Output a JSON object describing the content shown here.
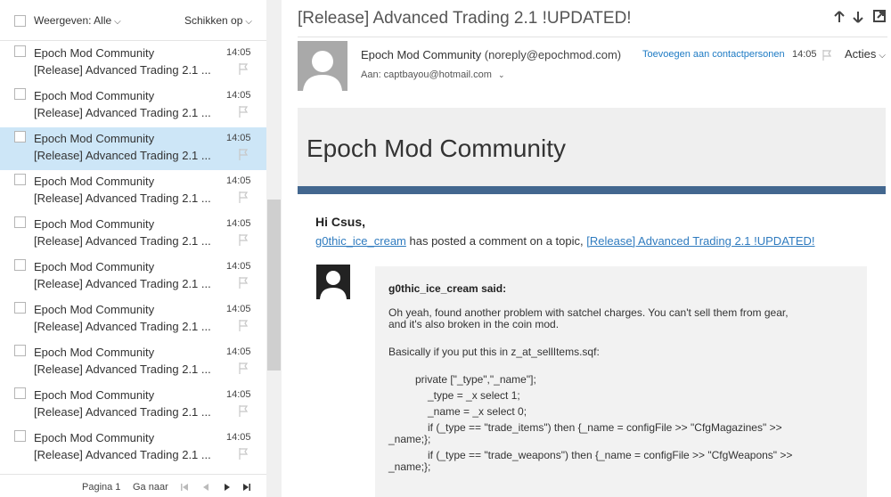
{
  "list": {
    "filter_label": "Weergeven: Alle",
    "sort_label": "Schikken op",
    "messages": [
      {
        "from": "Epoch Mod Community",
        "subject": "[Release] Advanced Trading 2.1 ...",
        "time": "14:05"
      },
      {
        "from": "Epoch Mod Community",
        "subject": "[Release] Advanced Trading 2.1 ...",
        "time": "14:05"
      },
      {
        "from": "Epoch Mod Community",
        "subject": "[Release] Advanced Trading 2.1 ...",
        "time": "14:05"
      },
      {
        "from": "Epoch Mod Community",
        "subject": "[Release] Advanced Trading 2.1 ...",
        "time": "14:05"
      },
      {
        "from": "Epoch Mod Community",
        "subject": "[Release] Advanced Trading 2.1 ...",
        "time": "14:05"
      },
      {
        "from": "Epoch Mod Community",
        "subject": "[Release] Advanced Trading 2.1 ...",
        "time": "14:05"
      },
      {
        "from": "Epoch Mod Community",
        "subject": "[Release] Advanced Trading 2.1 ...",
        "time": "14:05"
      },
      {
        "from": "Epoch Mod Community",
        "subject": "[Release] Advanced Trading 2.1 ...",
        "time": "14:05"
      },
      {
        "from": "Epoch Mod Community",
        "subject": "[Release] Advanced Trading 2.1 ...",
        "time": "14:05"
      },
      {
        "from": "Epoch Mod Community",
        "subject": "[Release] Advanced Trading 2.1 ...",
        "time": "14:05"
      }
    ],
    "selected_index": 2,
    "pager": {
      "page_label": "Pagina 1",
      "goto_label": "Ga naar"
    }
  },
  "reading": {
    "subject": "[Release] Advanced Trading 2.1 !UPDATED!",
    "sender_name": "Epoch Mod Community",
    "sender_email": "(noreply@epochmod.com)",
    "add_contact_label": "Toevoegen aan contactpersonen",
    "time": "14:05",
    "actions_label": "Acties",
    "to_line": "Aan: captbayou@hotmail.com"
  },
  "email": {
    "banner_title": "Epoch Mod Community",
    "greeting": "Hi Csus,",
    "intro_user": "g0thic_ice_cream",
    "intro_middle": " has posted a comment on a topic, ",
    "intro_topic": "[Release] Advanced Trading 2.1 !UPDATED!",
    "comment_author": "g0thic_ice_cream said:",
    "comment_lines": [
      "Oh yeah, found another problem with satchel charges. You can't sell them from gear,",
      "and it's also broken in the coin mod.",
      "Basically if you put this in z_at_sellItems.sqf:",
      "private [\"_type\",\"_name\"];",
      "_type = _x select 1;",
      "_name = _x select 0;",
      "if (_type == \"trade_items\") then {_name = configFile >> \"CfgMagazines\" >>",
      "_name;};",
      "if (_type == \"trade_weapons\") then {_name = configFile >> \"CfgWeapons\" >>",
      "_name;};"
    ]
  }
}
